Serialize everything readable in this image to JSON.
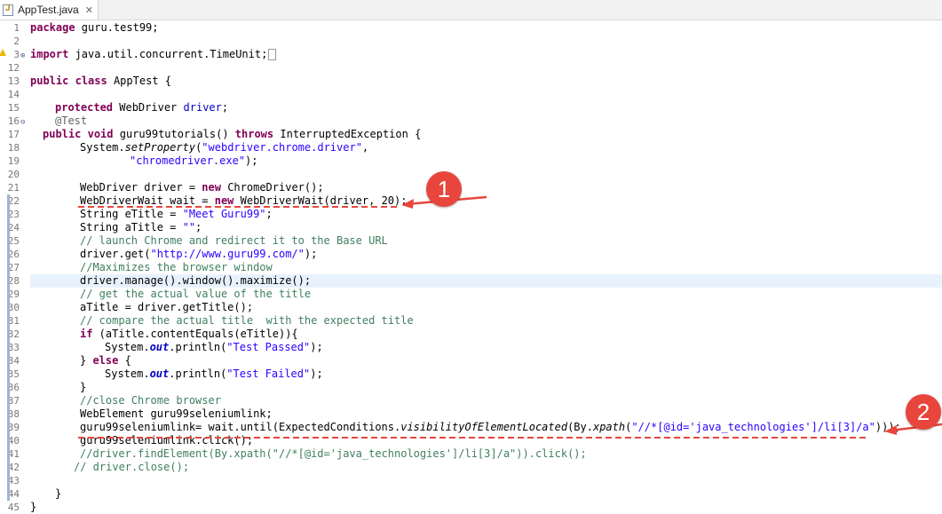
{
  "tab": {
    "title": "AppTest.java",
    "close_glyph": "✕"
  },
  "colors": {
    "keyword": "#7f0055",
    "string": "#2a00ff",
    "comment": "#3f7f5f",
    "field": "#0000c0",
    "annotation_red": "#e8463c",
    "current_line": "#e8f2fe"
  },
  "lines": [
    {
      "n": "1",
      "t": "package guru.test99;"
    },
    {
      "n": "2",
      "t": ""
    },
    {
      "n": "3",
      "t": "import java.util.concurrent.TimeUnit;"
    },
    {
      "n": "12",
      "t": ""
    },
    {
      "n": "13",
      "t": "public class AppTest {"
    },
    {
      "n": "14",
      "t": ""
    },
    {
      "n": "15",
      "t": "protected WebDriver driver;"
    },
    {
      "n": "16",
      "t": "@Test"
    },
    {
      "n": "17",
      "t": "public void guru99tutorials() throws InterruptedException {"
    },
    {
      "n": "18",
      "t": "System.setProperty(\"webdriver.chrome.driver\","
    },
    {
      "n": "19",
      "t": "\"chromedriver.exe\");"
    },
    {
      "n": "20",
      "t": ""
    },
    {
      "n": "21",
      "t": "WebDriver driver = new ChromeDriver();"
    },
    {
      "n": "22",
      "t": "WebDriverWait wait = new WebDriverWait(driver, 20);"
    },
    {
      "n": "23",
      "t": "String eTitle = \"Meet Guru99\";"
    },
    {
      "n": "24",
      "t": "String aTitle = \"\";"
    },
    {
      "n": "25",
      "t": "// launch Chrome and redirect it to the Base URL"
    },
    {
      "n": "26",
      "t": "driver.get(\"http://www.guru99.com/\");"
    },
    {
      "n": "27",
      "t": "//Maximizes the browser window"
    },
    {
      "n": "28",
      "t": "driver.manage().window().maximize();"
    },
    {
      "n": "29",
      "t": "// get the actual value of the title"
    },
    {
      "n": "30",
      "t": "aTitle = driver.getTitle();"
    },
    {
      "n": "31",
      "t": "// compare the actual title  with the expected title"
    },
    {
      "n": "32",
      "t": "if (aTitle.contentEquals(eTitle)){"
    },
    {
      "n": "33",
      "t": "System.out.println(\"Test Passed\");"
    },
    {
      "n": "34",
      "t": "} else {"
    },
    {
      "n": "35",
      "t": "System.out.println(\"Test Failed\");"
    },
    {
      "n": "36",
      "t": "}"
    },
    {
      "n": "37",
      "t": "//close Chrome browser"
    },
    {
      "n": "38",
      "t": "WebElement guru99seleniumlink;"
    },
    {
      "n": "39",
      "t": "guru99seleniumlink= wait.until(ExpectedConditions.visibilityOfElementLocated(By.xpath(\"//*[@id='java_technologies']/li[3]/a\")));"
    },
    {
      "n": "40",
      "t": "guru99seleniumlink.click();"
    },
    {
      "n": "41",
      "t": "//driver.findElement(By.xpath(\"//*[@id='java_technologies']/li[3]/a\")).click();"
    },
    {
      "n": "42",
      "t": "// driver.close();"
    },
    {
      "n": "43",
      "t": ""
    },
    {
      "n": "44",
      "t": "}"
    },
    {
      "n": "45",
      "t": "}"
    }
  ],
  "annotations": [
    {
      "label": "1"
    },
    {
      "label": "2"
    }
  ]
}
